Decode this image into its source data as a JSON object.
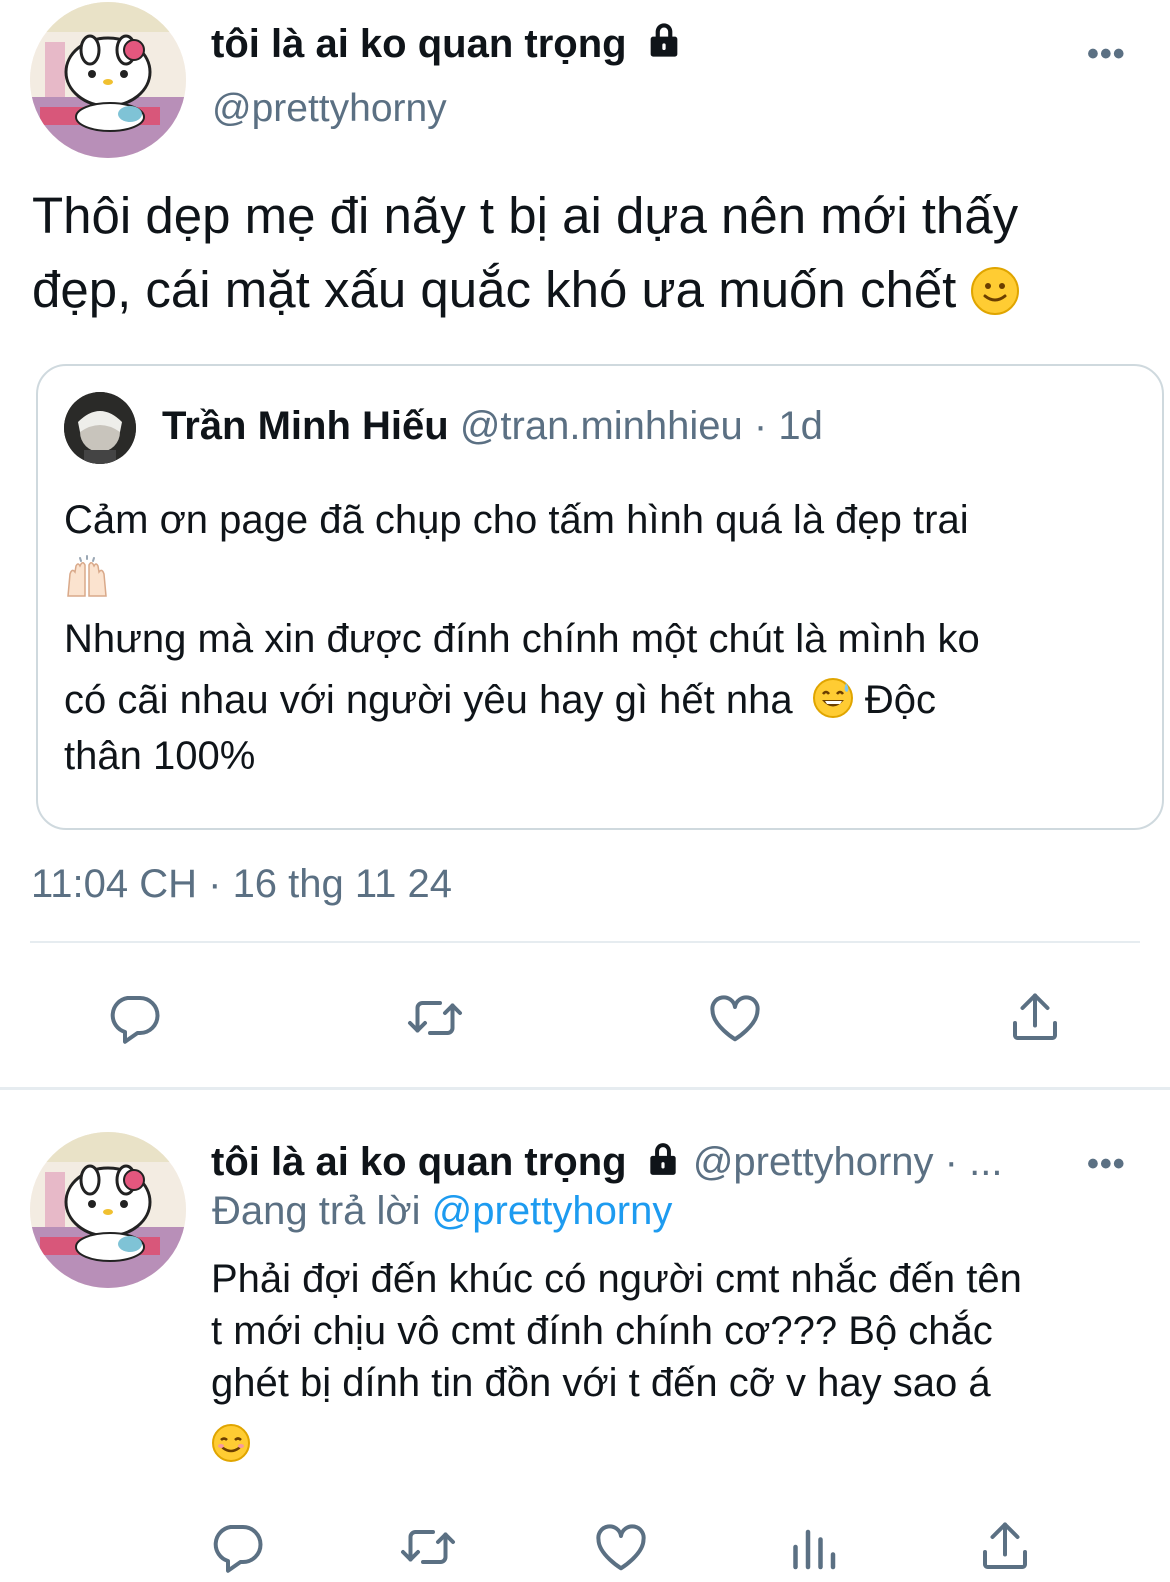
{
  "tweet": {
    "author_name": "tôi là ai ko quan trọng",
    "author_handle": "@prettyhorny",
    "more": "•••",
    "text_line1": "Thôi dẹp mẹ đi nãy t bị ai dựa nên mới thấy",
    "text_line2": "đẹp, cái mặt xấu quắc khó ưa muốn chết",
    "text_emoji": "🙂",
    "timestamp": "11:04 CH · 16 thg 11 24"
  },
  "quote": {
    "author_name": "Trần Minh Hiếu",
    "author_handle": "@tran.minhhieu",
    "age": "· 1d",
    "line1": "Cảm ơn page đã chụp cho tấm hình quá là đẹp trai",
    "emoji_raise": "🙌🏻",
    "line2": "Nhưng mà xin được đính chính một chút là mình ko",
    "line3": "có cãi nhau với người yêu hay gì hết nha",
    "emoji_sweat": "😅",
    "line3_tail": " Độc",
    "line4": "thân 100%"
  },
  "reply": {
    "author_name": "tôi là ai ko quan trọng",
    "author_handle": "@prettyhorny",
    "age": "· ...",
    "more": "•••",
    "replying_prefix": "Đang trả lời",
    "replying_to": "@prettyhorny",
    "line1": "Phải đợi đến khúc có người cmt nhắc đến tên",
    "line2": "t mới chịu vô cmt đính chính cơ??? Bộ chắc",
    "line3": "ghét bị dính tin đồn với t đến cỡ v hay sao á",
    "emoji": "☺️"
  },
  "icons": {
    "reply": "reply-icon",
    "retweet": "retweet-icon",
    "like": "heart-icon",
    "share": "share-icon",
    "analytics": "analytics-icon",
    "lock": "lock-icon"
  },
  "colors": {
    "link": "#1d9bf0",
    "secondary": "#5b7083",
    "border": "#cfd9de",
    "divider": "#e6ecf0"
  }
}
